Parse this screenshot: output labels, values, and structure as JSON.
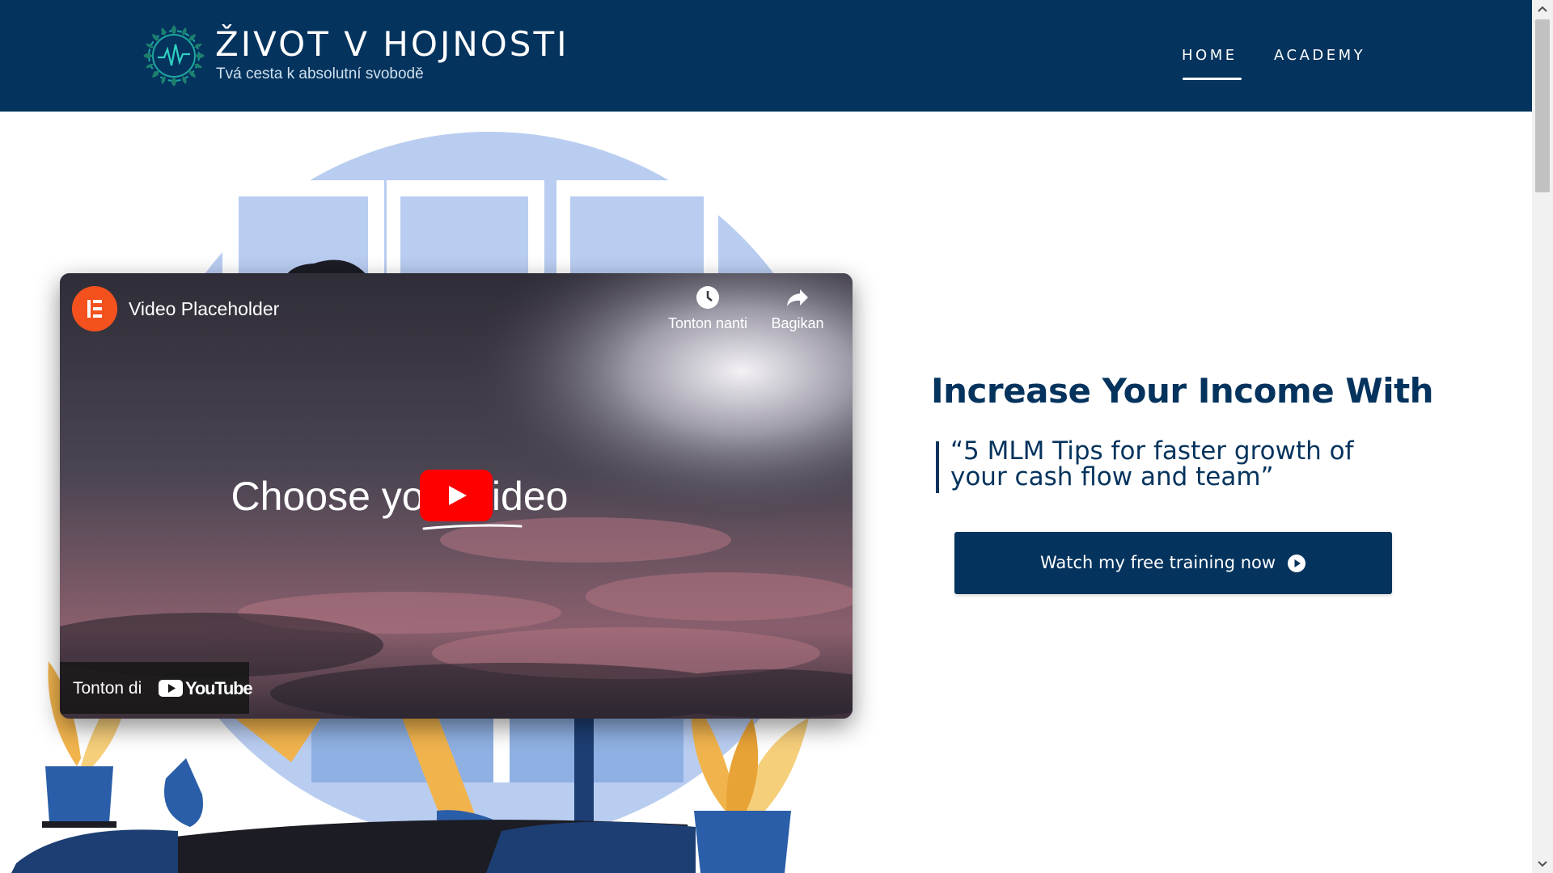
{
  "site": {
    "title": "ŽIVOT V HOJNOSTI",
    "tagline": "Tvá cesta k absolutní svobodě"
  },
  "nav": {
    "items": [
      {
        "label": "HOME",
        "active": true
      },
      {
        "label": "ACADEMY",
        "active": false
      }
    ]
  },
  "video": {
    "title": "Video Placeholder",
    "watch_later": "Tonton nanti",
    "share": "Bagikan",
    "center_text": "Choose your video",
    "watch_on": "Tonton di",
    "platform": "YouTube"
  },
  "hero": {
    "headline": "Increase Your Income With",
    "quote": "“5 MLM Tips for faster growth of your cash flow and team”",
    "cta_label": "Watch my free training now"
  },
  "colors": {
    "brand_navy": "#04335d",
    "youtube_red": "#ff0000",
    "elementor_orange": "#f4511e",
    "illustration_blue": "#b9cdf1"
  },
  "icons": [
    "logo-emblem-icon",
    "elementor-logo-icon",
    "clock-icon",
    "share-icon",
    "youtube-play-icon",
    "youtube-logo-icon",
    "play-circle-icon",
    "scroll-up-icon",
    "scroll-down-icon"
  ]
}
